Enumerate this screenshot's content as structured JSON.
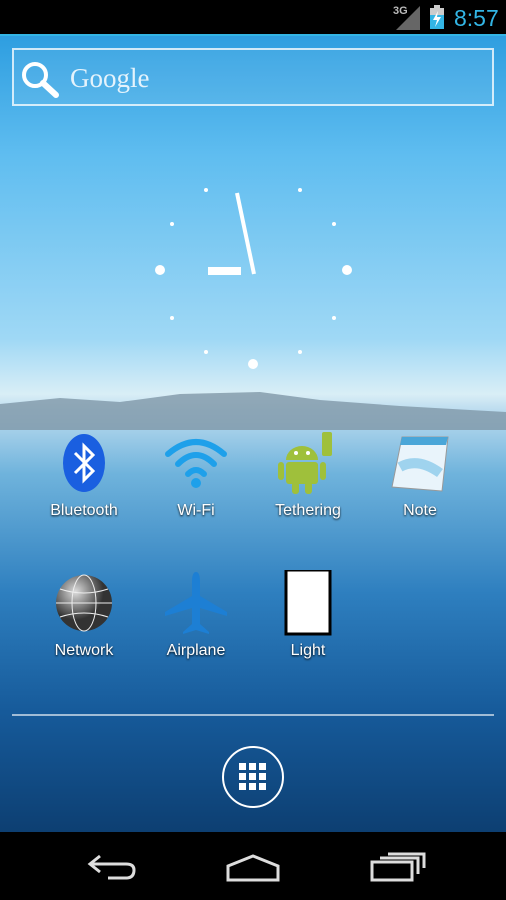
{
  "status_bar": {
    "network": "3G",
    "time": "8:57",
    "icons": [
      "signal-icon",
      "battery-charging-icon"
    ],
    "accent": "#33b5e5"
  },
  "search": {
    "label": "Google",
    "icon": "search-icon"
  },
  "clock": {
    "hour": 8,
    "minute": 57
  },
  "apps": [
    {
      "label": "Bluetooth",
      "icon": "bluetooth-icon"
    },
    {
      "label": "Wi-Fi",
      "icon": "wifi-icon"
    },
    {
      "label": "Tethering",
      "icon": "android-usb-icon"
    },
    {
      "label": "Note",
      "icon": "notepad-icon"
    },
    {
      "label": "Network",
      "icon": "globe-icon"
    },
    {
      "label": "Airplane",
      "icon": "airplane-icon"
    },
    {
      "label": "Light",
      "icon": "light-icon"
    }
  ],
  "dock": {
    "icon": "app-drawer-icon"
  },
  "nav": {
    "icons": [
      "back-icon",
      "home-icon",
      "recents-icon"
    ]
  }
}
